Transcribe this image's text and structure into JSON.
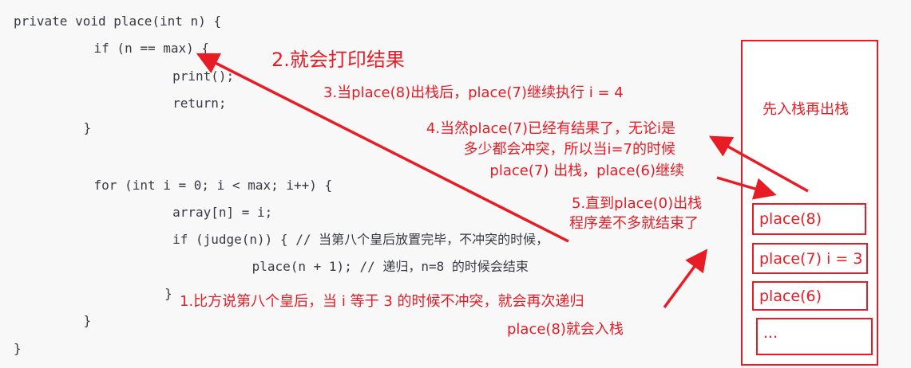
{
  "code_lines": [
    "private void place(int n) {",
    "    if (n == max) {",
    "        print();",
    "        return;",
    "    }",
    "",
    "    for (int i = 0; i < max; i++) {",
    "        array[n] = i;",
    "        if (judge(n)) { // 当第八个皇后放置完毕，不冲突的时候，",
    "            place(n + 1); // 递归，n=8 的时候会结束",
    "        }",
    "    }",
    "}"
  ],
  "annotations": {
    "note1_line1": "1.比方说第八个皇后，当 i 等于 3 的时候不冲突，就会再次递归",
    "note1_line2": "place(8)就会入栈",
    "note2": "2.就会打印结果",
    "note3": "3.当place(8)出栈后，place(7)继续执行 i = 4",
    "note4_line1": "4.当然place(7)已经有结果了，无论i是",
    "note4_line2": "多少都会冲突，所以当i=7的时候",
    "note4_line3": "place(7) 出栈，place(6)继续",
    "note5_line1": "5.直到place(0)出栈",
    "note5_line2": "程序差不多就结束了"
  },
  "stack": {
    "title": "先入栈再出栈",
    "frames": [
      "place(8)",
      "place(7) i = 3",
      "place(6)",
      "..."
    ]
  },
  "colors": {
    "annotation": "#e81c24",
    "code_bg": "#f8f8f9",
    "code_text": "#383a42"
  }
}
